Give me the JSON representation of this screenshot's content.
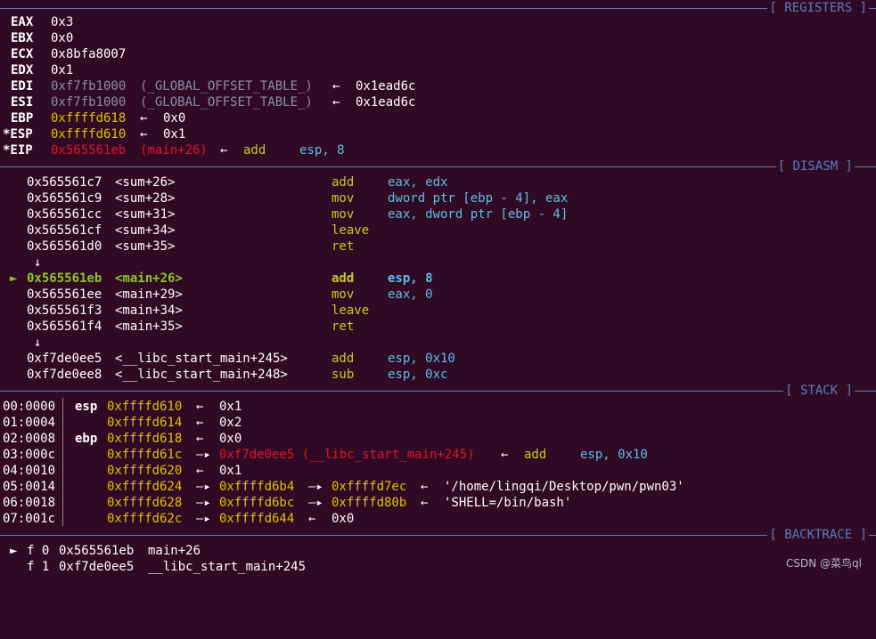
{
  "sections": {
    "registers": "[ REGISTERS ]",
    "disasm": "[ DISASM ]",
    "stack": "[ STACK ]",
    "backtrace": "[ BACKTRACE ]"
  },
  "registers": [
    {
      "name": "EAX",
      "value": "0x3"
    },
    {
      "name": "EBX",
      "value": "0x0"
    },
    {
      "name": "ECX",
      "value": "0x8bfa8007"
    },
    {
      "name": "EDX",
      "value": "0x1"
    },
    {
      "name": "EDI",
      "value": "0xf7fb1000",
      "sym": "(_GLOBAL_OFFSET_TABLE_)",
      "arrow": "←",
      "target": "0x1ead6c"
    },
    {
      "name": "ESI",
      "value": "0xf7fb1000",
      "sym": "(_GLOBAL_OFFSET_TABLE_)",
      "arrow": "←",
      "target": "0x1ead6c"
    },
    {
      "name": "EBP",
      "value": "0xffffd618",
      "arrow": "←",
      "target": "0x0"
    },
    {
      "name": "*ESP",
      "value": "0xffffd610",
      "arrow": "←",
      "target": "0x1"
    },
    {
      "name": "*EIP",
      "value": "0x565561eb",
      "sym": "(main+26)",
      "arrow": "←",
      "op": "add",
      "args": "esp, 8"
    }
  ],
  "disasm": [
    {
      "addr": "0x565561c7",
      "sym": "<sum+26>",
      "op": "add",
      "args": "eax, edx"
    },
    {
      "addr": "0x565561c9",
      "sym": "<sum+28>",
      "op": "mov",
      "args": "dword ptr [ebp - 4], eax"
    },
    {
      "addr": "0x565561cc",
      "sym": "<sum+31>",
      "op": "mov",
      "args": "eax, dword ptr [ebp - 4]"
    },
    {
      "addr": "0x565561cf",
      "sym": "<sum+34>",
      "op": "leave",
      "args": ""
    },
    {
      "addr": "0x565561d0",
      "sym": "<sum+35>",
      "op": "ret",
      "args": ""
    },
    {
      "addr": "0x565561eb",
      "sym": "<main+26>",
      "op": "add",
      "args": "esp, 8",
      "current": "►"
    },
    {
      "addr": "0x565561ee",
      "sym": "<main+29>",
      "op": "mov",
      "args": "eax, 0"
    },
    {
      "addr": "0x565561f3",
      "sym": "<main+34>",
      "op": "leave",
      "args": ""
    },
    {
      "addr": "0x565561f4",
      "sym": "<main+35>",
      "op": "ret",
      "args": ""
    },
    {
      "addr": "0xf7de0ee5",
      "sym": "<__libc_start_main+245>",
      "op": "add",
      "args": "esp, 0x10"
    },
    {
      "addr": "0xf7de0ee8",
      "sym": "<__libc_start_main+248>",
      "op": "sub",
      "args": "esp, 0xc"
    }
  ],
  "jump_arrow": "↓",
  "stack": [
    {
      "index": "00:0000",
      "reg": "esp",
      "addr": "0xffffd610",
      "arrow": "←",
      "value": "0x1"
    },
    {
      "index": "01:0004",
      "reg": "",
      "addr": "0xffffd614",
      "arrow": "←",
      "value": "0x2"
    },
    {
      "index": "02:0008",
      "reg": "ebp",
      "addr": "0xffffd618",
      "arrow": "←",
      "value": "0x0"
    },
    {
      "index": "03:000c",
      "reg": "",
      "addr": "0xffffd61c",
      "arrow": "—▸",
      "value": "0xf7de0ee5 (__libc_start_main+245)",
      "arrow2": "←",
      "op": "add",
      "args": "esp, 0x10"
    },
    {
      "index": "04:0010",
      "reg": "",
      "addr": "0xffffd620",
      "arrow": "←",
      "value": "0x1"
    },
    {
      "index": "05:0014",
      "reg": "",
      "addr": "0xffffd624",
      "arrow": "—▸",
      "value": "0xffffd6b4",
      "arrow2": "—▸",
      "value2": "0xffffd7ec",
      "arrow3": "←",
      "str": "'/home/lingqi/Desktop/pwn/pwn03'"
    },
    {
      "index": "06:0018",
      "reg": "",
      "addr": "0xffffd628",
      "arrow": "—▸",
      "value": "0xffffd6bc",
      "arrow2": "—▸",
      "value2": "0xffffd80b",
      "arrow3": "←",
      "str": "'SHELL=/bin/bash'"
    },
    {
      "index": "07:001c",
      "reg": "",
      "addr": "0xffffd62c",
      "arrow": "—▸",
      "value": "0xffffd644",
      "arrow2": "←",
      "value2": "0x0"
    }
  ],
  "backtrace": [
    {
      "marker": "►",
      "frame": "f 0",
      "addr": "0x565561eb",
      "func": "main+26"
    },
    {
      "marker": "",
      "frame": "f 1",
      "addr": "0xf7de0ee5",
      "func": "__libc_start_main+245"
    }
  ],
  "watermark": "CSDN @菜鸟ql"
}
